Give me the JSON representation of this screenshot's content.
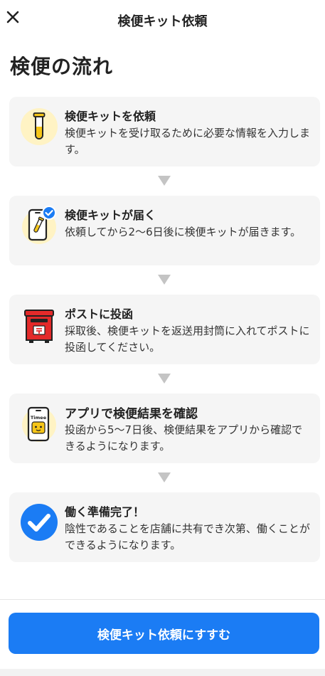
{
  "header": {
    "title": "検便キット依頼",
    "close_icon": "close-icon"
  },
  "page_title": "検便の流れ",
  "steps": [
    {
      "title": "検便キットを依頼",
      "desc": "検便キットを受け取るために必要な情報を入力します。",
      "icon": "test-tube-icon"
    },
    {
      "title": "検便キットが届く",
      "desc": "依頼してから2〜6日後に検便キットが届きます。",
      "icon": "phone-kit-check-icon"
    },
    {
      "title": "ポストに投函",
      "desc": "採取後、検便キットを返送用封筒に入れてポストに投函してください。",
      "icon": "postbox-icon"
    },
    {
      "title": "アプリで検便結果を確認",
      "desc": "投函から5〜7日後、検便結果をアプリから確認できるようになります。",
      "icon": "phone-app-icon",
      "app_label": "Timee"
    },
    {
      "title": "働く準備完了！",
      "desc": "陰性であることを店舗に共有でき次第、働くことができるようになります。",
      "icon": "check-circle-icon"
    }
  ],
  "cta_label": "検便キット依頼にすすむ",
  "colors": {
    "accent": "#1b7cf4",
    "card_bg": "#f5f5f5",
    "arrow": "#c4c4c4",
    "yellow": "#fff3c4",
    "tube": "#f5c518",
    "post_red": "#e32a2a"
  }
}
